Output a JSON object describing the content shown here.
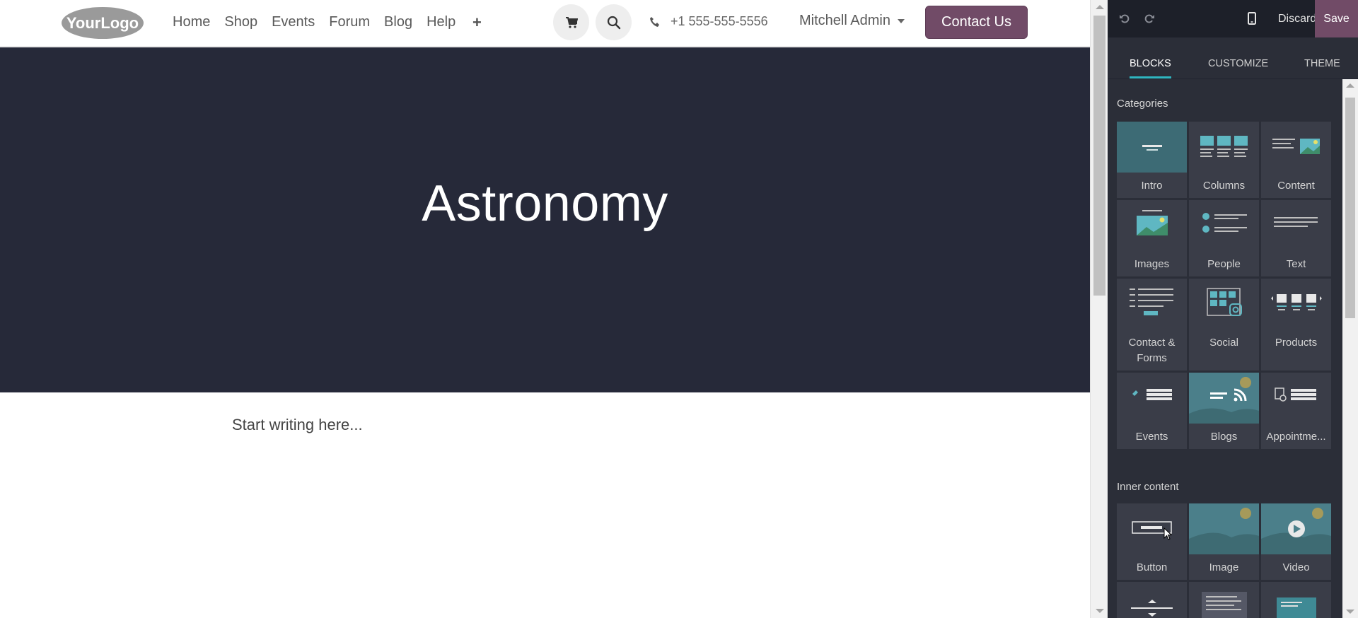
{
  "site": {
    "logo_text": "YourLogo",
    "nav": [
      "Home",
      "Shop",
      "Events",
      "Forum",
      "Blog",
      "Help"
    ],
    "phone": "+1 555-555-5556",
    "user": "Mitchell Admin",
    "contact_label": "Contact Us",
    "hero_title": "Astronomy",
    "placeholder": "Start writing here...",
    "colors": {
      "hero_bg": "#262939",
      "brand": "#714b67"
    }
  },
  "editor": {
    "discard_label": "Discard",
    "save_label": "Save",
    "tabs": [
      "BLOCKS",
      "CUSTOMIZE",
      "THEME"
    ],
    "active_tab": "BLOCKS",
    "categories_title": "Categories",
    "categories": [
      "Intro",
      "Columns",
      "Content",
      "Images",
      "People",
      "Text",
      "Contact & Forms",
      "Social",
      "Products",
      "Events",
      "Blogs",
      "Appointme..."
    ],
    "inner_title": "Inner content",
    "inner": [
      "Button",
      "Image",
      "Video"
    ],
    "colors": {
      "accent": "#2fb6c0",
      "panel": "#2b2e38",
      "tile": "#3a3d48"
    }
  }
}
